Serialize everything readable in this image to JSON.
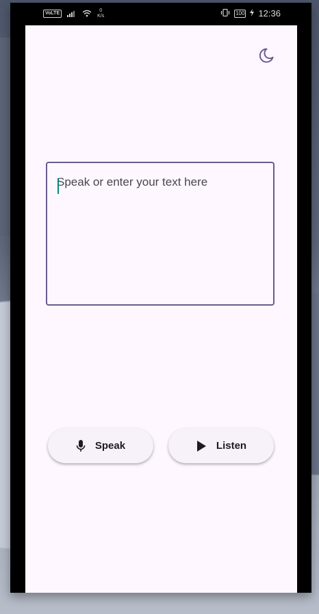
{
  "status_bar": {
    "volte": "VoLTE",
    "speed_value": "0",
    "speed_unit": "K/s",
    "battery": "100",
    "time": "12:36"
  },
  "header": {
    "theme_toggle_icon": "moon-icon"
  },
  "input": {
    "value": "",
    "placeholder": "Speak or enter your text here"
  },
  "actions": {
    "speak_label": "Speak",
    "speak_icon": "microphone-icon",
    "listen_label": "Listen",
    "listen_icon": "play-icon"
  },
  "colors": {
    "background": "#fef7ff",
    "accent": "#6a5a8f",
    "button_bg": "#f7f2fa",
    "caret": "#00897b"
  }
}
